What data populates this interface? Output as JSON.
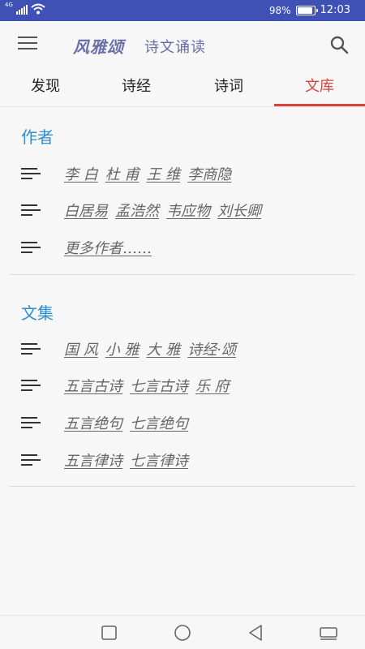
{
  "status_bar": {
    "network_type": "4G",
    "battery_text": "98%",
    "battery_level": 0.98,
    "time": "12:03"
  },
  "app_bar": {
    "title": "风雅颂",
    "subtitle": "诗文诵读",
    "menu_icon": "hamburger-menu-icon",
    "search_icon": "search-icon"
  },
  "tabs": [
    {
      "label": "发现",
      "active": false
    },
    {
      "label": "诗经",
      "active": false
    },
    {
      "label": "诗词",
      "active": false
    },
    {
      "label": "文库",
      "active": true
    }
  ],
  "sections": [
    {
      "title": "作者",
      "rows": [
        [
          "李 白",
          "杜 甫",
          "王 维",
          "李商隐"
        ],
        [
          "白居易",
          "孟浩然",
          "韦应物",
          "刘长卿"
        ],
        [
          "更多作者……"
        ]
      ]
    },
    {
      "title": "文集",
      "rows": [
        [
          "国 风",
          "小 雅",
          "大 雅",
          "诗经·颂"
        ],
        [
          "五言古诗",
          "七言古诗",
          "乐 府"
        ],
        [
          "五言绝句",
          "七言绝句"
        ],
        [
          "五言律诗",
          "七言律诗"
        ]
      ]
    }
  ],
  "colors": {
    "status_bar": "#3f51b5",
    "active_tab": "#d9433e",
    "section_title": "#2f8fd1",
    "app_title": "#6a6fa8"
  },
  "nav_bar": {
    "icons": [
      "recent-apps-icon",
      "home-icon",
      "back-icon",
      "notification-shade-icon"
    ]
  }
}
